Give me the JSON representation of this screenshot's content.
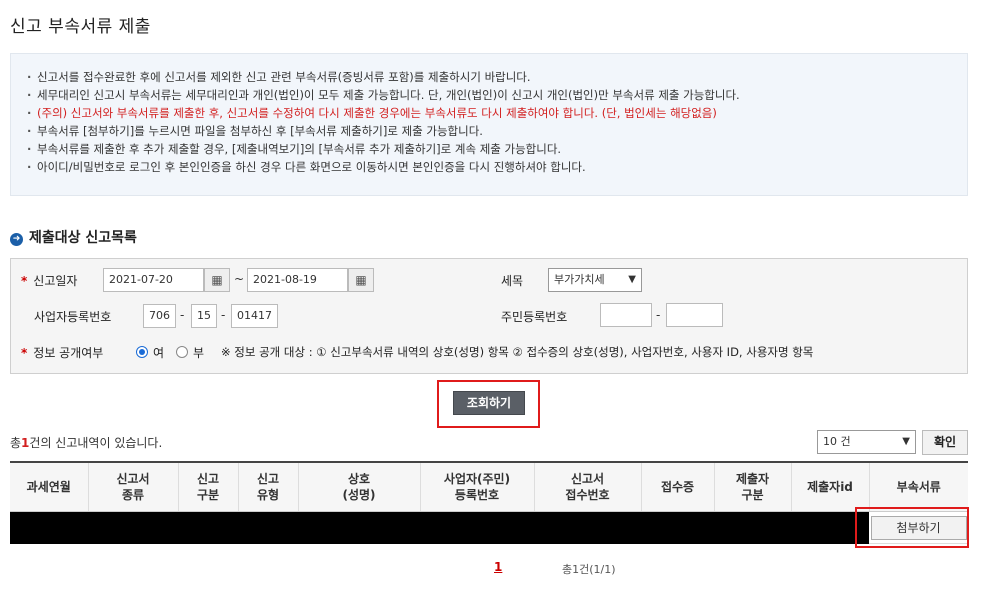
{
  "page_title": "신고 부속서류 제출",
  "notices": [
    {
      "text": "신고서를 접수완료한 후에 신고서를 제외한 신고 관련 부속서류(증빙서류 포함)를 제출하시기 바랍니다.",
      "red": false
    },
    {
      "text": "세무대리인 신고시 부속서류는 세무대리인과 개인(법인)이 모두 제출 가능합니다. 단, 개인(법인)이 신고시 개인(법인)만 부속서류 제출 가능합니다.",
      "red": false
    },
    {
      "text": "(주의) 신고서와 부속서류를 제출한 후, 신고서를 수정하여 다시 제출한 경우에는 부속서류도 다시 제출하여야 합니다. (단, 법인세는 해당없음)",
      "red": true
    },
    {
      "text": "부속서류 [첨부하기]를 누르시면 파일을 첨부하신 후 [부속서류 제출하기]로 제출 가능합니다.",
      "red": false
    },
    {
      "text": "부속서류를 제출한 후 추가 제출할 경우, [제출내역보기]의 [부속서류 추가 제출하기]로 계속 제출 가능합니다.",
      "red": false
    },
    {
      "text": "아이디/비밀번호로 로그인 후 본인인증을 하신 경우 다른 화면으로 이동하시면 본인인증을 다시 진행하셔야 합니다.",
      "red": false
    }
  ],
  "section_title": "제출대상 신고목록",
  "search": {
    "req_mark": "*",
    "date_label": "신고일자",
    "date_from": "2021-07-20",
    "date_to": "2021-08-19",
    "tilde": "~",
    "tax_label": "세목",
    "tax_value": "부가가치세",
    "bizno_label": "사업자등록번호",
    "bizno": [
      "706",
      "15",
      "01417"
    ],
    "dash": "-",
    "resno_label": "주민등록번호",
    "resno": [
      "",
      ""
    ],
    "disclose_label": "정보 공개여부",
    "opt_yes": "여",
    "opt_no": "부",
    "disclose_note": "※ 정보 공개 대상 : ① 신고부속서류 내역의 상호(성명) 항목 ② 접수증의 상호(성명), 사업자번호, 사용자 ID, 사용자명 항목",
    "search_button": "조회하기"
  },
  "results": {
    "count_prefix": "총",
    "count_value": "1",
    "count_suffix": "건의 신고내역이 있습니다.",
    "page_size": "10 건",
    "confirm_button": "확인"
  },
  "table": {
    "headers": [
      "과세연월",
      "신고서\n종류",
      "신고\n구분",
      "신고\n유형",
      "상호\n(성명)",
      "사업자(주민)\n등록번호",
      "신고서\n접수번호",
      "접수증",
      "제출자\n구분",
      "제출자id",
      "부속서류"
    ],
    "attach_button": "첨부하기"
  },
  "pagination": {
    "current": "1",
    "info": "총1건(1/1)"
  },
  "colors": {
    "highlight": "#e01b1b",
    "notice_bg": "#f2f6fb",
    "section_icon": "#1b5fa8"
  }
}
